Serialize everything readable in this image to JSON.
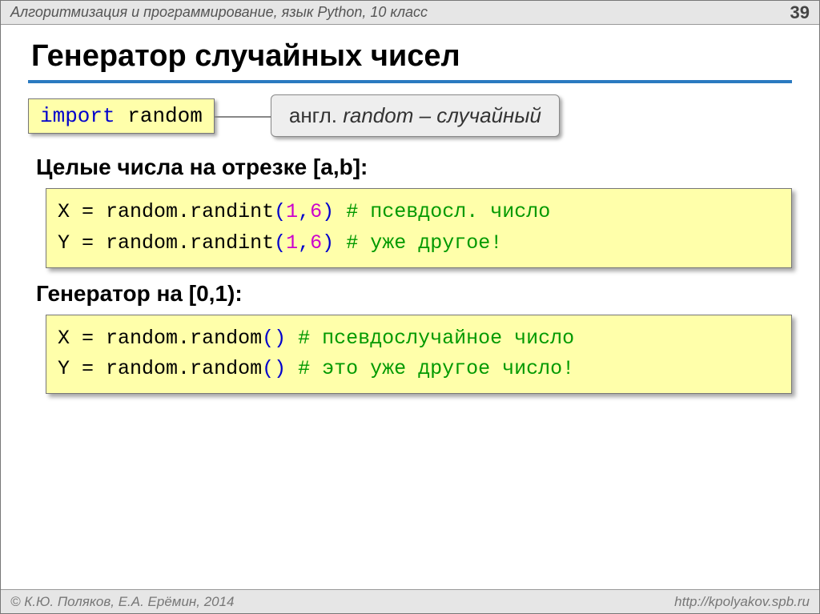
{
  "header": {
    "title": "Алгоритмизация и программирование, язык Python, 10 класс",
    "page": "39"
  },
  "slide": {
    "title": "Генератор случайных чисел"
  },
  "import_box": {
    "kw": "import",
    "mod": "random"
  },
  "callout": {
    "prefix": "англ. ",
    "word": "random",
    "suffix": " – случайный"
  },
  "sec1": {
    "head": "Целые числа на отрезке [a,b]:"
  },
  "code1": {
    "l1": {
      "lhs": "X",
      "eq": " = ",
      "mod": "random",
      "dot": ".",
      "fn": "randint",
      "op": "(",
      "a1": "1",
      "comma": ",",
      "a2": "6",
      "cp": ")",
      "sp": "  ",
      "cmt": "# псевдосл. число"
    },
    "l2": {
      "lhs": "Y",
      "eq": " = ",
      "mod": "random",
      "dot": ".",
      "fn": "randint",
      "op": "(",
      "a1": "1",
      "comma": ",",
      "a2": "6",
      "cp": ")",
      "sp": "  ",
      "cmt": "# уже другое!"
    }
  },
  "sec2": {
    "head": "Генератор на [0,1):"
  },
  "code2": {
    "l1": {
      "lhs": "X",
      "eq": " = ",
      "mod": "random",
      "dot": ".",
      "fn": "random",
      "op": "()",
      "sp": "   ",
      "cmt": "# псевдослучайное число"
    },
    "l2": {
      "lhs": "Y",
      "eq": " = ",
      "mod": "random",
      "dot": ".",
      "fn": "random",
      "op": "()",
      "sp": "   ",
      "cmt": "# это уже другое число!"
    }
  },
  "footer": {
    "left": "© К.Ю. Поляков, Е.А. Ерёмин, 2014",
    "right": "http://kpolyakov.spb.ru"
  }
}
